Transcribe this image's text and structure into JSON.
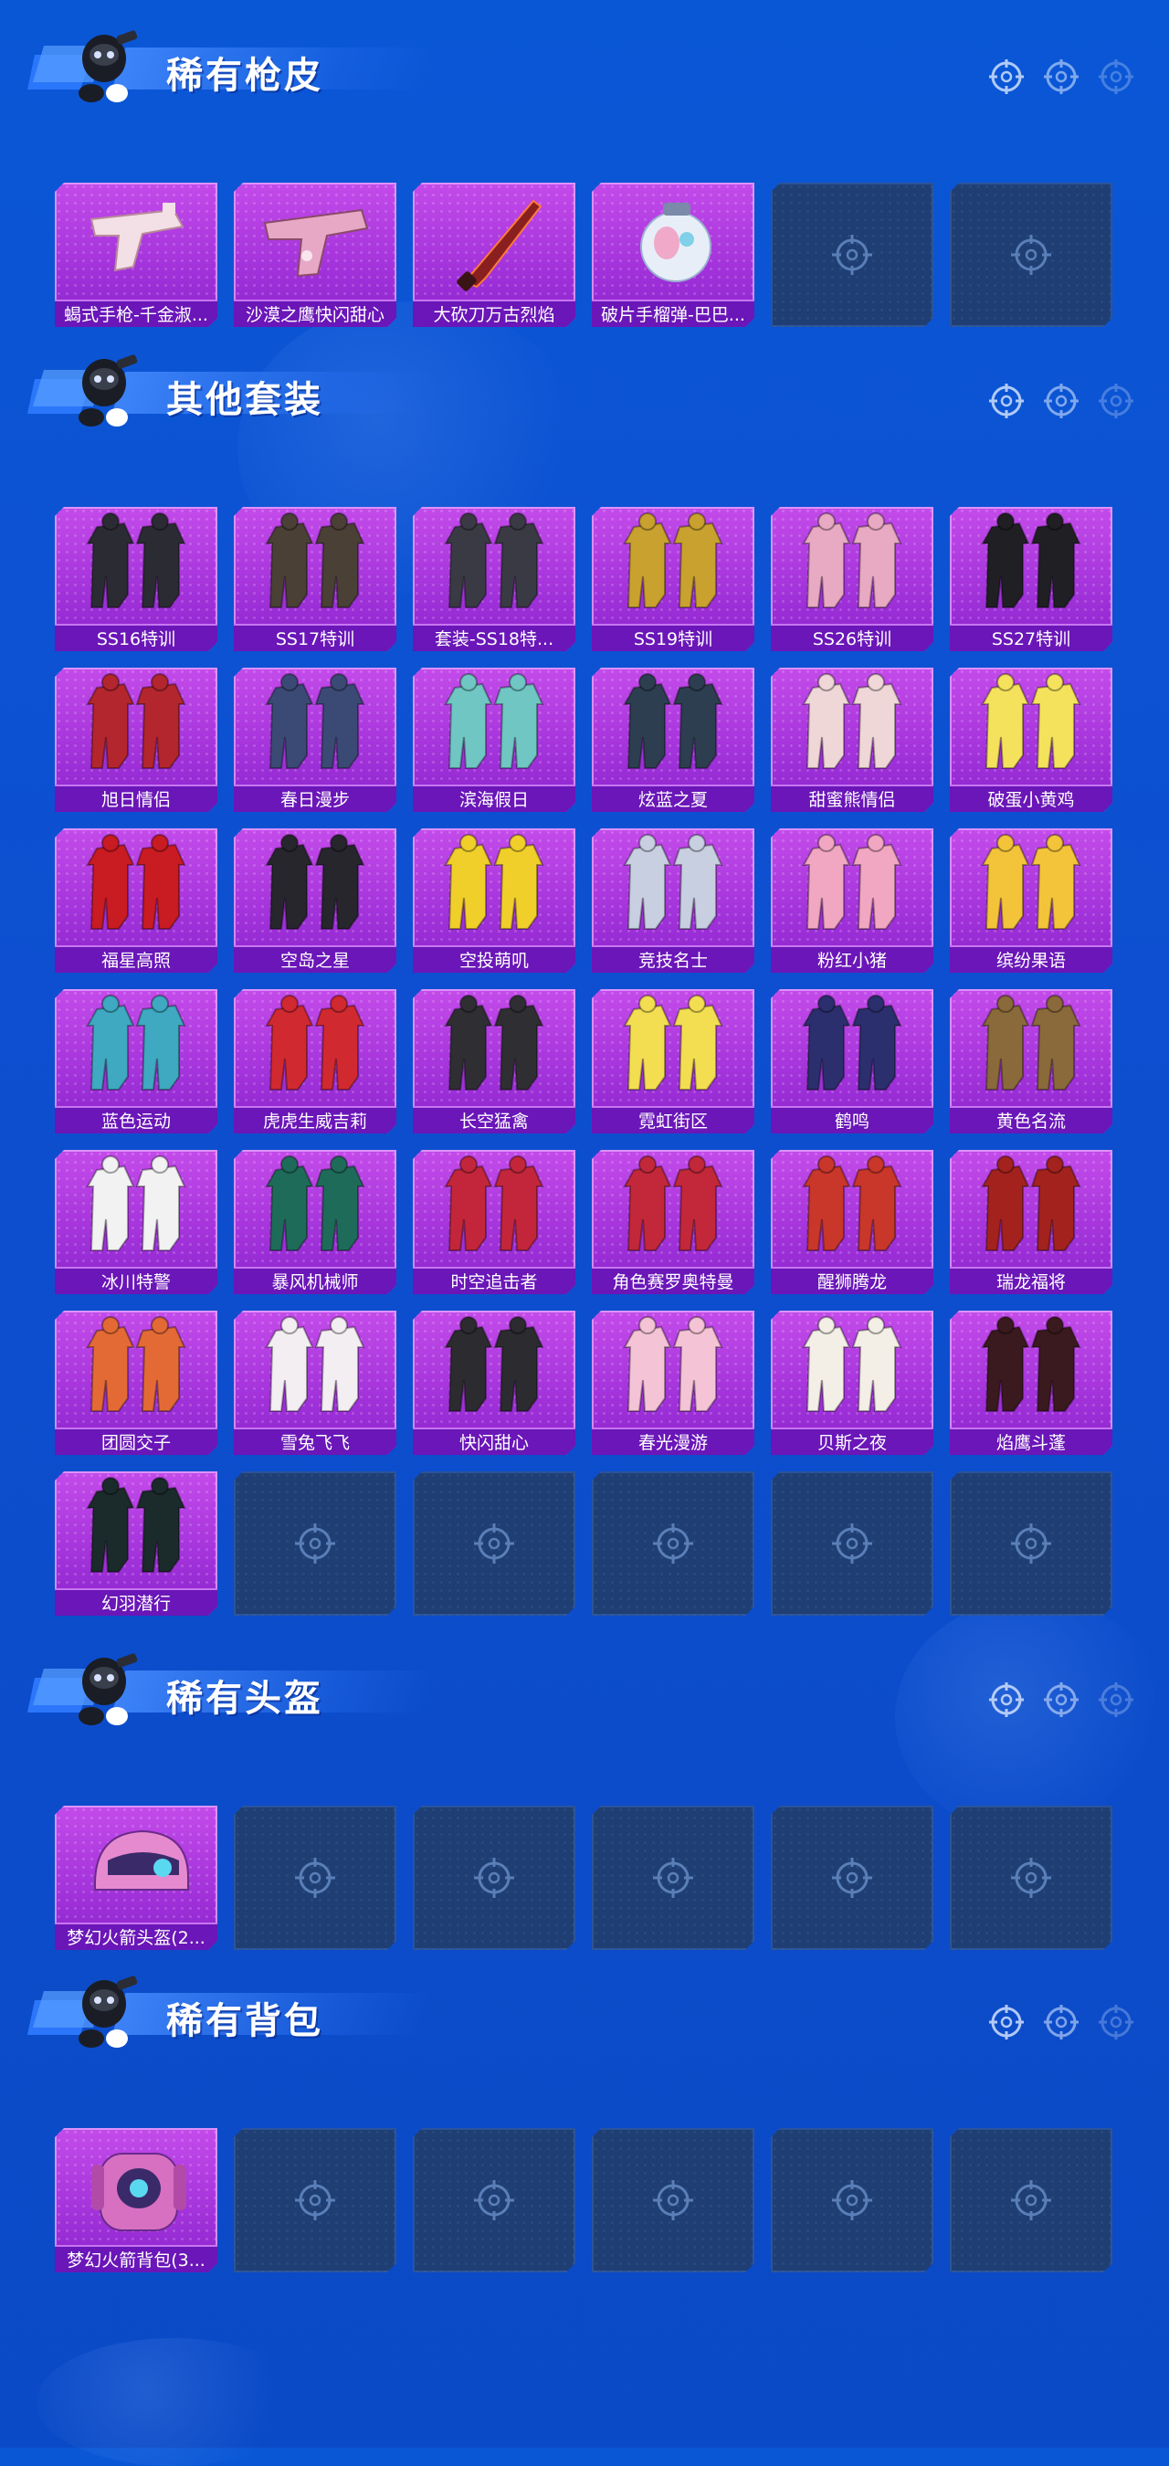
{
  "sections": [
    {
      "id": "guns",
      "title": "稀有枪皮",
      "empty_slots": 2,
      "items": [
        {
          "label": "蝎式手枪-千金淑...",
          "icon": "pistol-icon",
          "color": "#f3dfe6"
        },
        {
          "label": "沙漠之鹰快闪甜心",
          "icon": "desert-eagle-icon",
          "color": "#e7a8c6"
        },
        {
          "label": "大砍刀万古烈焰",
          "icon": "machete-icon",
          "color": "#8a1f1f"
        },
        {
          "label": "破片手榴弹-巴巴...",
          "icon": "grenade-icon",
          "color": "#e8eef7"
        }
      ]
    },
    {
      "id": "outfits",
      "title": "其他套装",
      "empty_slots": 5,
      "items": [
        {
          "label": "SS16特训",
          "icon": "outfit-icon",
          "color": "#2b2b33"
        },
        {
          "label": "SS17特训",
          "icon": "outfit-icon",
          "color": "#4a4036"
        },
        {
          "label": "套装-SS18特...",
          "icon": "outfit-icon",
          "color": "#3a3a44"
        },
        {
          "label": "SS19特训",
          "icon": "outfit-icon",
          "color": "#c9a12e"
        },
        {
          "label": "SS26特训",
          "icon": "outfit-icon",
          "color": "#e8a9c2"
        },
        {
          "label": "SS27特训",
          "icon": "outfit-icon",
          "color": "#1f1f24"
        },
        {
          "label": "旭日情侣",
          "icon": "outfit-icon",
          "color": "#b3262d"
        },
        {
          "label": "春日漫步",
          "icon": "outfit-icon",
          "color": "#3b4a75"
        },
        {
          "label": "滨海假日",
          "icon": "outfit-icon",
          "color": "#6fc6c2"
        },
        {
          "label": "炫蓝之夏",
          "icon": "outfit-icon",
          "color": "#2c3e50"
        },
        {
          "label": "甜蜜熊情侣",
          "icon": "outfit-icon",
          "color": "#f0d7d7"
        },
        {
          "label": "破蛋小黄鸡",
          "icon": "outfit-icon",
          "color": "#f5e25c"
        },
        {
          "label": "福星高照",
          "icon": "outfit-icon",
          "color": "#c91b22"
        },
        {
          "label": "空岛之星",
          "icon": "outfit-icon",
          "color": "#26262c"
        },
        {
          "label": "空投萌叽",
          "icon": "outfit-icon",
          "color": "#f0cf2a"
        },
        {
          "label": "竞技名士",
          "icon": "outfit-icon",
          "color": "#c7cfe0"
        },
        {
          "label": "粉红小猪",
          "icon": "outfit-icon",
          "color": "#f1a7c1"
        },
        {
          "label": "缤纷果语",
          "icon": "outfit-icon",
          "color": "#f3c43a"
        },
        {
          "label": "蓝色运动",
          "icon": "outfit-icon",
          "color": "#3ea9c1"
        },
        {
          "label": "虎虎生威吉莉",
          "icon": "outfit-icon",
          "color": "#d12930"
        },
        {
          "label": "长空猛禽",
          "icon": "outfit-icon",
          "color": "#2f2f33"
        },
        {
          "label": "霓虹街区",
          "icon": "outfit-icon",
          "color": "#f3de52"
        },
        {
          "label": "鹤鸣",
          "icon": "outfit-icon",
          "color": "#2b2f6e"
        },
        {
          "label": "黄色名流",
          "icon": "outfit-icon",
          "color": "#8a6a3a"
        },
        {
          "label": "冰川特警",
          "icon": "outfit-icon",
          "color": "#f2f2f2"
        },
        {
          "label": "暴风机械师",
          "icon": "outfit-icon",
          "color": "#1f6b5a"
        },
        {
          "label": "时空追击者",
          "icon": "outfit-icon",
          "color": "#c3263a"
        },
        {
          "label": "角色赛罗奥特曼",
          "icon": "outfit-icon",
          "color": "#c2283a"
        },
        {
          "label": "醒狮腾龙",
          "icon": "outfit-icon",
          "color": "#c9362a"
        },
        {
          "label": "瑞龙福将",
          "icon": "outfit-icon",
          "color": "#a3221d"
        },
        {
          "label": "团圆交子",
          "icon": "outfit-icon",
          "color": "#e46a35"
        },
        {
          "label": "雪兔飞飞",
          "icon": "outfit-icon",
          "color": "#f3eef2"
        },
        {
          "label": "快闪甜心",
          "icon": "outfit-icon",
          "color": "#2b2b30"
        },
        {
          "label": "春光漫游",
          "icon": "outfit-icon",
          "color": "#f4c4d6"
        },
        {
          "label": "贝斯之夜",
          "icon": "outfit-icon",
          "color": "#f3eee6"
        },
        {
          "label": "焰鹰斗蓬",
          "icon": "outfit-icon",
          "color": "#3a1a1e"
        },
        {
          "label": "幻羽潜行",
          "icon": "outfit-icon",
          "color": "#1b2a2a"
        }
      ]
    },
    {
      "id": "helmets",
      "title": "稀有头盔",
      "empty_slots": 5,
      "items": [
        {
          "label": "梦幻火箭头盔(2...",
          "icon": "helmet-icon",
          "color": "#e68ad0"
        }
      ]
    },
    {
      "id": "backpacks",
      "title": "稀有背包",
      "empty_slots": 5,
      "items": [
        {
          "label": "梦幻火箭背包(3...",
          "icon": "backpack-icon",
          "color": "#d870c2"
        }
      ]
    }
  ],
  "colors": {
    "background": "#0b50cc",
    "card_purple": "#a232da",
    "label_bar": "#6a16b8",
    "empty_slot": "#1f3f74"
  }
}
